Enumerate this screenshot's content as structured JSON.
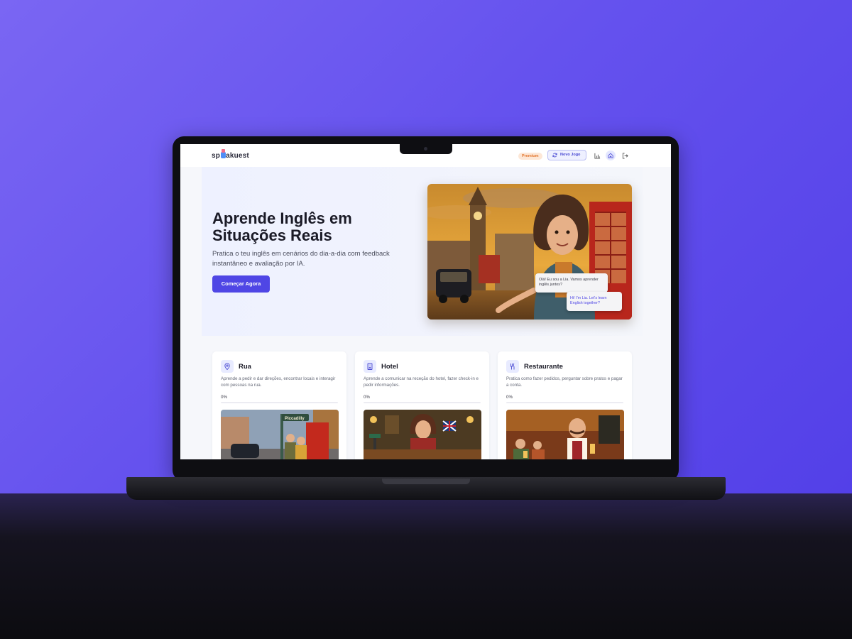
{
  "brand": {
    "logo_prefix": "sp",
    "logo_suffix": "akuest"
  },
  "nav": {
    "premium_label": "Premium",
    "new_game_label": "Novo Jogo",
    "icons": [
      "bar-chart-icon",
      "home-icon",
      "logout-icon"
    ]
  },
  "hero": {
    "title": "Aprende Inglês em Situações Reais",
    "subtitle": "Pratica o teu inglês em cenários do dia-a-dia com feedback instantâneo e avaliação por IA.",
    "cta_label": "Começar Agora",
    "bubble_pt": "Olá! Eu sou a Lia. Vamos aprender inglês juntos?",
    "bubble_en": "Hi! I'm Lia. Let's learn English together?"
  },
  "cards": [
    {
      "title": "Rua",
      "icon": "map-pin-icon",
      "description": "Aprende a pedir e dar direções, encontrar locais e interagir com pessoas na rua.",
      "progress_label": "0%",
      "progress": 0,
      "sign": "Piccadilly"
    },
    {
      "title": "Hotel",
      "icon": "building-icon",
      "description": "Aprende a comunicar na receção do hotel, fazer check-in e pedir informações.",
      "progress_label": "0%",
      "progress": 0
    },
    {
      "title": "Restaurante",
      "icon": "utensils-icon",
      "description": "Pratica como fazer pedidos, perguntar sobre pratos e pagar a conta.",
      "progress_label": "0%",
      "progress": 0
    }
  ],
  "colors": {
    "accent": "#4f46e5",
    "background": "#6552ee",
    "premium": "#e2772f"
  }
}
